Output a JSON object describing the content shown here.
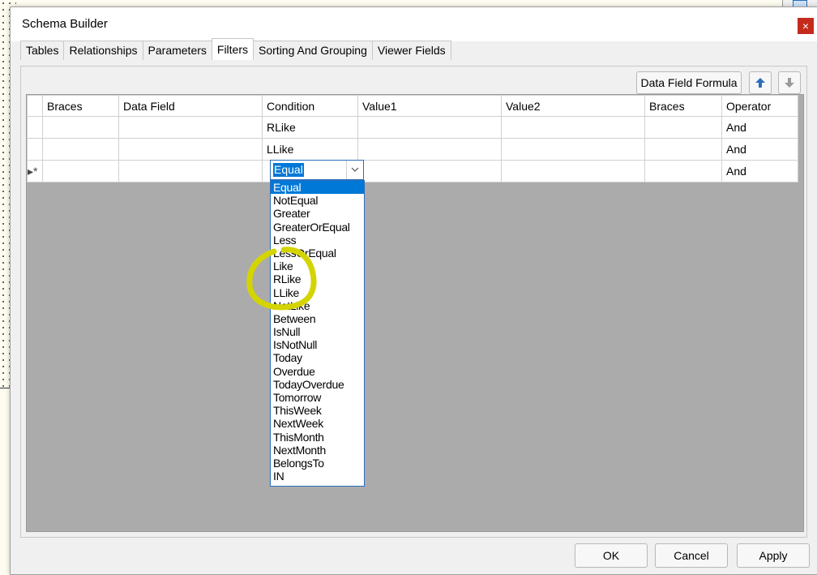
{
  "window": {
    "title": "Schema Builder",
    "close_glyph": "×"
  },
  "tabs": [
    {
      "label": "Tables"
    },
    {
      "label": "Relationships"
    },
    {
      "label": "Parameters"
    },
    {
      "label": "Filters",
      "active": true
    },
    {
      "label": "Sorting And Grouping"
    },
    {
      "label": "Viewer Fields"
    }
  ],
  "toolbar": {
    "formula_label": "Data Field Formula",
    "move_up_icon": "arrow-up-icon",
    "move_down_icon": "arrow-down-icon"
  },
  "grid": {
    "columns": [
      "Braces",
      "Data Field",
      "Condition",
      "Value1",
      "Value2",
      "Braces",
      "Operator"
    ],
    "rows": [
      {
        "marker": "",
        "braces_open": "",
        "data_field": "",
        "condition": "RLike",
        "value1": "",
        "value2": "",
        "braces_close": "",
        "operator": "And"
      },
      {
        "marker": "",
        "braces_open": "",
        "data_field": "",
        "condition": "LLike",
        "value1": "",
        "value2": "",
        "braces_close": "",
        "operator": "And"
      },
      {
        "marker": "▸*",
        "braces_open": "",
        "data_field": "",
        "condition": "Equal",
        "value1": "",
        "value2": "",
        "braces_close": "",
        "operator": "And"
      }
    ]
  },
  "condition_editor": {
    "value": "Equal",
    "options": [
      "Equal",
      "NotEqual",
      "Greater",
      "GreaterOrEqual",
      "Less",
      "LessOrEqual",
      "Like",
      "RLike",
      "LLike",
      "NotLike",
      "Between",
      "IsNull",
      "IsNotNull",
      "Today",
      "Overdue",
      "TodayOverdue",
      "Tomorrow",
      "ThisWeek",
      "NextWeek",
      "ThisMonth",
      "NextMonth",
      "BelongsTo",
      "IN"
    ],
    "selected_index": 0
  },
  "annotation": {
    "color": "#d4d400"
  },
  "footer": {
    "ok_label": "OK",
    "cancel_label": "Cancel",
    "apply_label": "Apply"
  },
  "colors": {
    "accent": "#0078d7",
    "close": "#c42b1c",
    "grid_bg": "#ababab"
  }
}
